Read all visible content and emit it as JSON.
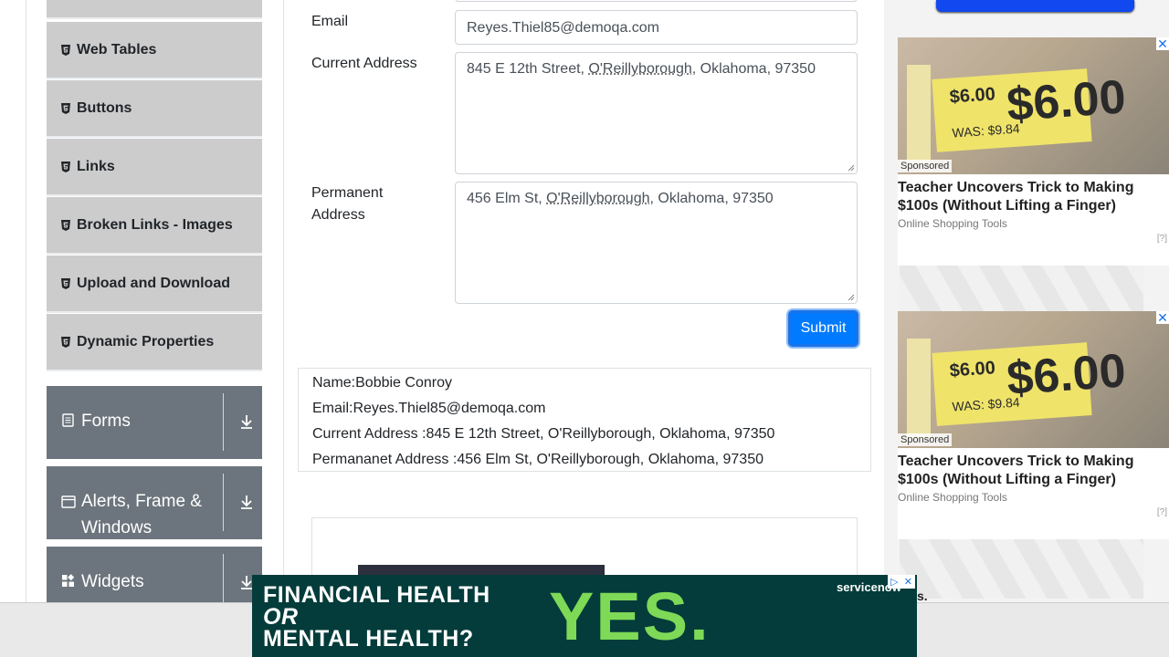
{
  "sidebar": {
    "items": [
      {
        "label": "Web Tables"
      },
      {
        "label": "Buttons"
      },
      {
        "label": "Links"
      },
      {
        "label": "Broken Links - Images"
      },
      {
        "label": "Upload and Download"
      },
      {
        "label": "Dynamic Properties"
      }
    ],
    "groups": [
      {
        "label": "Forms",
        "icon": "form-icon"
      },
      {
        "label": "Alerts, Frame &",
        "label2": "Windows",
        "icon": "window-icon"
      },
      {
        "label": "Widgets",
        "icon": "widgets-icon"
      }
    ]
  },
  "form": {
    "email_label": "Email",
    "email_value": "Reyes.Thiel85@demoqa.com",
    "current_address_label": "Current Address",
    "current_address_value_a": "845 E 12th Street, ",
    "current_address_value_b": "O'Reillyborough",
    "current_address_value_c": ", Oklahoma, 97350",
    "permanent_address_label_1": "Permanent",
    "permanent_address_label_2": "Address",
    "permanent_address_value_a": "456 Elm St, ",
    "permanent_address_value_b": "O'Reillyborough",
    "permanent_address_value_c": ", Oklahoma, 97350",
    "submit_label": "Submit"
  },
  "output": {
    "name": "Name:Bobbie Conroy",
    "email": "Email:Reyes.Thiel85@demoqa.com",
    "current_address": "Current Address :845 E 12th Street, O'Reillyborough, Oklahoma, 97350",
    "permanent_address": "Permananet Address :456 Elm St, O'Reillyborough, Oklahoma, 97350"
  },
  "ads": {
    "cards": [
      {
        "sponsored": "Sponsored",
        "headline": "Teacher Uncovers Trick to Making $100s (Without Lifting a Finger)",
        "source": "Online Shopping Tools",
        "adchoice": "[?]"
      },
      {
        "sponsored": "Sponsored",
        "headline": "Teacher Uncovers Trick to Making $100s (Without Lifting a Finger)",
        "source": "Online Shopping Tools",
        "adchoice": "[?]"
      }
    ],
    "tag_big": "$6.00",
    "tag_small": "$6.00",
    "tag_was": "WAS: $9.84",
    "close_glyph": "✕",
    "banner": {
      "line1": "FINANCIAL HEALTH",
      "line2": "OR",
      "line3": "MENTAL HEALTH?",
      "yes": "YES.",
      "brand": "servicenow"
    },
    "bleed_text": "s."
  },
  "colors": {
    "accent": "#007bff",
    "sidebar_item_bg": "#cccccc",
    "group_bg": "#6c757d",
    "banner_bg": "#033c3a",
    "banner_yes": "#7ed957"
  }
}
